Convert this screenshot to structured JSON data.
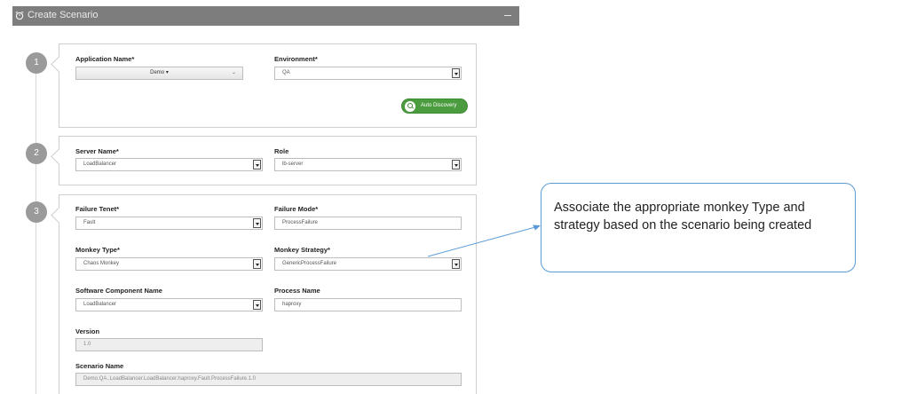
{
  "window": {
    "title": "Create Scenario",
    "title_icon": "alarm-clock-icon",
    "minimize_icon": "minimize-icon"
  },
  "steps": [
    "1",
    "2",
    "3"
  ],
  "section1": {
    "app_label": "Application Name*",
    "app_value": "Demo",
    "env_label": "Environment*",
    "env_value": "QA",
    "auto_discovery": "Auto Discovery",
    "auto_icon": "search-icon"
  },
  "section2": {
    "server_label": "Server Name*",
    "server_value": "LoadBalancer",
    "role_label": "Role",
    "role_value": "lb-server"
  },
  "section3": {
    "tenet_label": "Failure Tenet*",
    "tenet_value": "Fault",
    "mode_label": "Failure Mode*",
    "mode_value": "ProcessFailure",
    "monkey_type_label": "Monkey Type*",
    "monkey_type_value": "Chaos Monkey",
    "strategy_label": "Monkey Strategy*",
    "strategy_value": "GenericProcessFailure",
    "component_label": "Software Component Name",
    "component_value": "LoadBalancer",
    "process_label": "Process Name",
    "process_value": "haproxy",
    "version_label": "Version",
    "version_value": "1.0",
    "scenario_label": "Scenario Name",
    "scenario_value": "Demo.QA..LoadBalancer.LoadBalancer.haproxy.Fault.ProcessFailure.1.0"
  },
  "callout": {
    "text": "Associate the appropriate monkey Type and strategy based on the scenario being created"
  },
  "colors": {
    "titlebar": "#7d7d7d",
    "accent_green": "#4b9c3f",
    "callout_border": "#5b9bd5",
    "step_circle": "#9a9a9a"
  }
}
